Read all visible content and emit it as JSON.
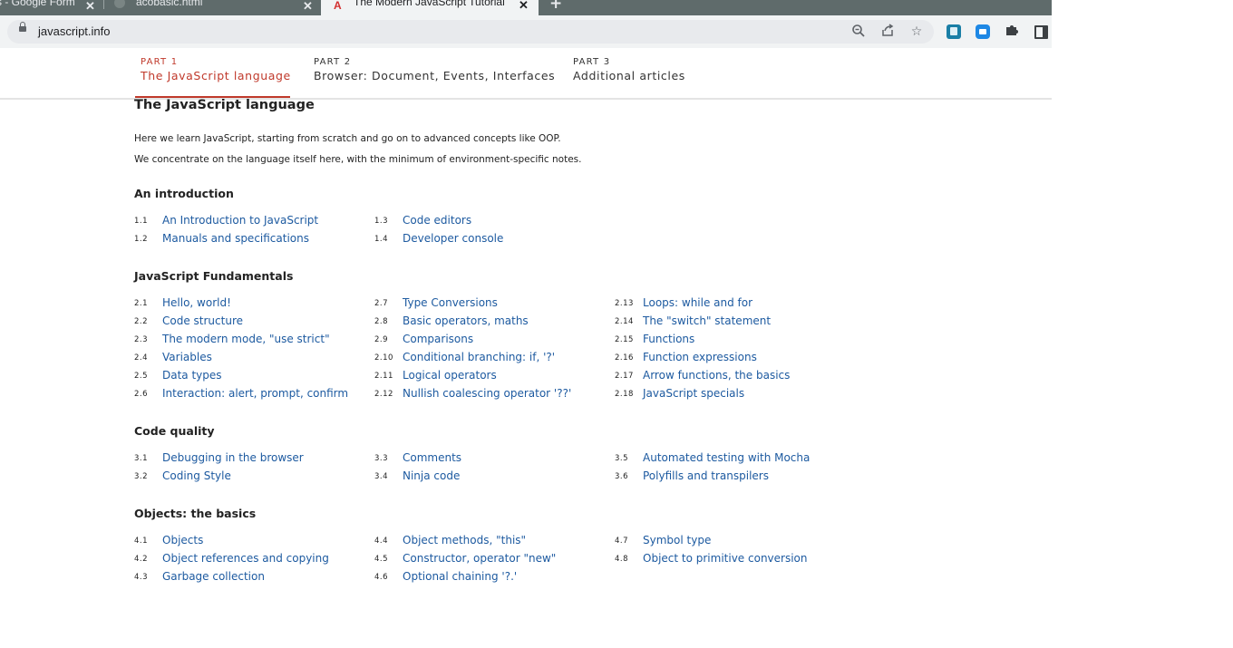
{
  "browser": {
    "tabs": [
      {
        "title": "s - Google Form"
      },
      {
        "title": "acobasic.html"
      },
      {
        "title": "The Modern JavaScript Tutorial"
      }
    ],
    "url": "javascript.info",
    "icons": [
      "lock-icon",
      "zoom-icon",
      "share-icon",
      "star-icon",
      "book-extension-icon",
      "video-extension-icon",
      "puzzle-icon",
      "side-panel-icon"
    ]
  },
  "nav": {
    "parts": [
      {
        "num": "PART 1",
        "name": "The JavaScript language"
      },
      {
        "num": "PART 2",
        "name": "Browser: Document, Events, Interfaces"
      },
      {
        "num": "PART 3",
        "name": "Additional articles"
      }
    ]
  },
  "page": {
    "title": "The JavaScript language",
    "intro": [
      "Here we learn JavaScript, starting from scratch and go on to advanced concepts like OOP.",
      "We concentrate on the language itself here, with the minimum of environment-specific notes."
    ]
  },
  "sections": [
    {
      "title": "An introduction",
      "columns": [
        [
          {
            "num": "1.1",
            "title": "An Introduction to JavaScript"
          },
          {
            "num": "1.2",
            "title": "Manuals and specifications"
          }
        ],
        [
          {
            "num": "1.3",
            "title": "Code editors"
          },
          {
            "num": "1.4",
            "title": "Developer console"
          }
        ]
      ]
    },
    {
      "title": "JavaScript Fundamentals",
      "columns": [
        [
          {
            "num": "2.1",
            "title": "Hello, world!"
          },
          {
            "num": "2.2",
            "title": "Code structure"
          },
          {
            "num": "2.3",
            "title": "The modern mode, \"use strict\""
          },
          {
            "num": "2.4",
            "title": "Variables"
          },
          {
            "num": "2.5",
            "title": "Data types"
          },
          {
            "num": "2.6",
            "title": "Interaction: alert, prompt, confirm"
          }
        ],
        [
          {
            "num": "2.7",
            "title": "Type Conversions"
          },
          {
            "num": "2.8",
            "title": "Basic operators, maths"
          },
          {
            "num": "2.9",
            "title": "Comparisons"
          },
          {
            "num": "2.10",
            "title": "Conditional branching: if, '?'"
          },
          {
            "num": "2.11",
            "title": "Logical operators"
          },
          {
            "num": "2.12",
            "title": "Nullish coalescing operator '??'"
          }
        ],
        [
          {
            "num": "2.13",
            "title": "Loops: while and for"
          },
          {
            "num": "2.14",
            "title": "The \"switch\" statement"
          },
          {
            "num": "2.15",
            "title": "Functions"
          },
          {
            "num": "2.16",
            "title": "Function expressions"
          },
          {
            "num": "2.17",
            "title": "Arrow functions, the basics"
          },
          {
            "num": "2.18",
            "title": "JavaScript specials"
          }
        ]
      ]
    },
    {
      "title": "Code quality",
      "columns": [
        [
          {
            "num": "3.1",
            "title": "Debugging in the browser"
          },
          {
            "num": "3.2",
            "title": "Coding Style"
          }
        ],
        [
          {
            "num": "3.3",
            "title": "Comments"
          },
          {
            "num": "3.4",
            "title": "Ninja code"
          }
        ],
        [
          {
            "num": "3.5",
            "title": "Automated testing with Mocha"
          },
          {
            "num": "3.6",
            "title": "Polyfills and transpilers"
          }
        ]
      ]
    },
    {
      "title": "Objects: the basics",
      "columns": [
        [
          {
            "num": "4.1",
            "title": "Objects"
          },
          {
            "num": "4.2",
            "title": "Object references and copying"
          },
          {
            "num": "4.3",
            "title": "Garbage collection"
          }
        ],
        [
          {
            "num": "4.4",
            "title": "Object methods, \"this\""
          },
          {
            "num": "4.5",
            "title": "Constructor, operator \"new\""
          },
          {
            "num": "4.6",
            "title": "Optional chaining '?.'"
          }
        ],
        [
          {
            "num": "4.7",
            "title": "Symbol type"
          },
          {
            "num": "4.8",
            "title": "Object to primitive conversion"
          }
        ]
      ]
    }
  ]
}
